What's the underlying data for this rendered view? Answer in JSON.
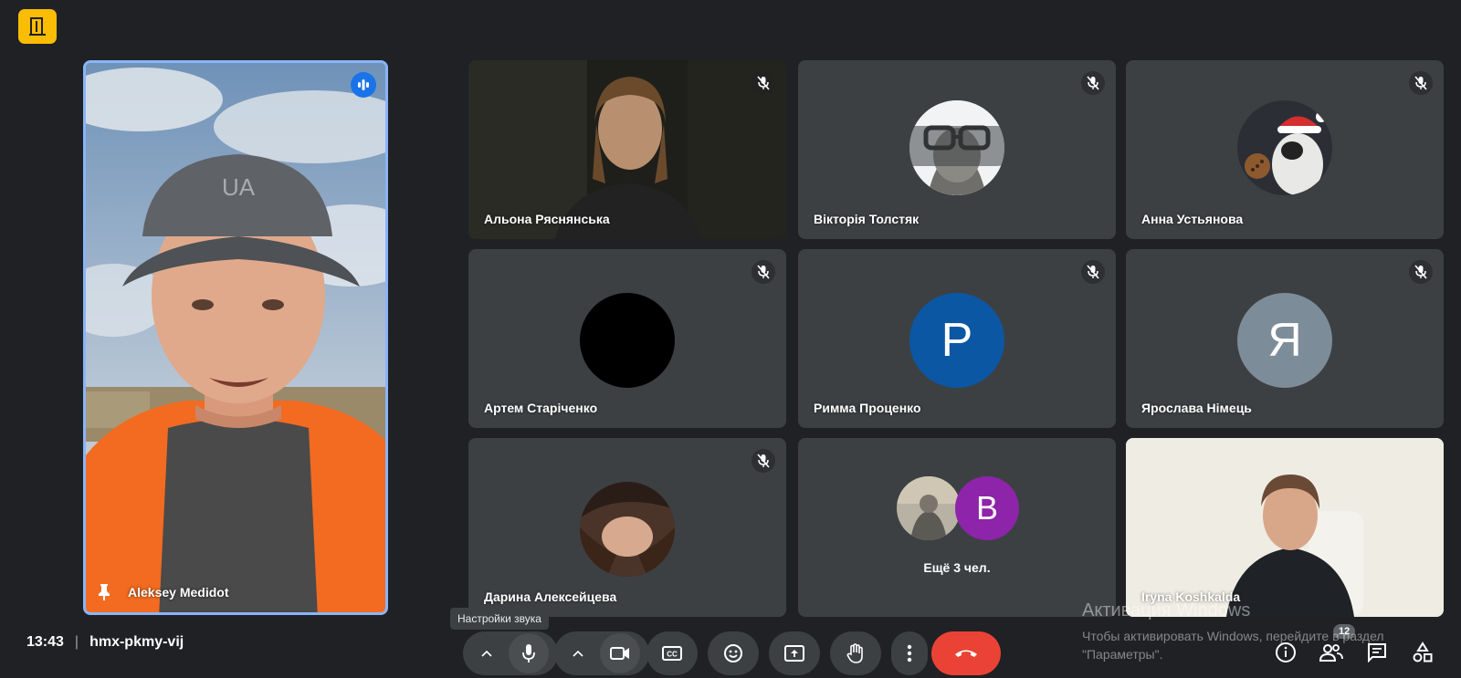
{
  "app_icon": "door-icon",
  "pinned": {
    "name": "Aleksey Medidot",
    "pin_icon": "pin-icon",
    "speaking_icon": "speaking-indicator-icon"
  },
  "tiles": [
    {
      "name": "Альона Ряснянська",
      "type": "video",
      "muted": true
    },
    {
      "name": "Вікторія Толстяк",
      "type": "avatar-image",
      "muted": true
    },
    {
      "name": "Анна Устьянова",
      "type": "avatar-image",
      "muted": true
    },
    {
      "name": "Артем Старіченко",
      "type": "avatar-black",
      "muted": true
    },
    {
      "name": "Римма Проценко",
      "type": "avatar-letter",
      "letter": "Р",
      "color": "#0b57a4",
      "muted": true
    },
    {
      "name": "Ярослава Німець",
      "type": "avatar-letter",
      "letter": "Я",
      "color": "#7d8c99",
      "muted": true
    },
    {
      "name": "Дарина Алексейцева",
      "type": "avatar-image",
      "muted": true
    },
    {
      "name": "Ещё 3 чел.",
      "type": "group",
      "letter": "В",
      "color": "#8e24aa"
    },
    {
      "name": "Iryna Koshkalda",
      "type": "video"
    }
  ],
  "tooltip": "Настройки звука",
  "meeting": {
    "time": "13:43",
    "separator": "|",
    "code": "hmx-pkmy-vij"
  },
  "controls": {
    "people_count": "12"
  },
  "watermark": {
    "line1": "Активация Windows",
    "line2": "Чтобы активировать Windows, перейдите в раздел",
    "line3": "\"Параметры\"."
  },
  "colors": {
    "background": "#202124",
    "tile": "#3c4043",
    "active_border": "#8ab4f8",
    "hangup": "#ea4335",
    "app_icon_bg": "#fbbc04"
  }
}
